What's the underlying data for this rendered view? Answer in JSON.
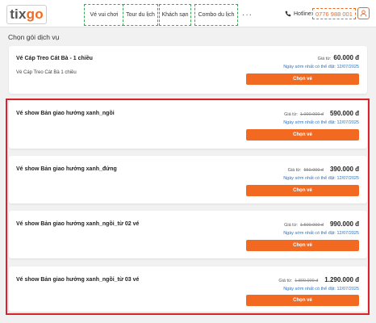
{
  "header": {
    "logo": {
      "tix": "tix",
      "go": "go"
    },
    "nav": [
      "Vé vui chơi",
      "Tour du lịch",
      "Khách sạn",
      "Combo du lịch"
    ],
    "more": "···",
    "hotline_label": "Hotline:",
    "hotline_number": "0776 988 001"
  },
  "section_title": "Chọn gói dịch vụ",
  "packages": [
    {
      "name": "Vé Cáp Treo Cát Bà - 1 chiều",
      "description": "Vé Cáp Treo Cát Bà 1 chiều",
      "price_label": "Giá từ:",
      "old_price": "",
      "price": "60.000 đ",
      "date_note": "Ngày sớm nhất có thể đặt: 12/07/2025",
      "button": "Chọn vé"
    },
    {
      "name": "Vé show Bản giao hưởng xanh_ngồi",
      "description": "",
      "price_label": "Giá từ:",
      "old_price": "1.000.000 đ",
      "price": "590.000 đ",
      "date_note": "Ngày sớm nhất có thể đặt: 12/07/2025",
      "button": "Chọn vé"
    },
    {
      "name": "Vé show Bản giao hưởng xanh_đứng",
      "description": "",
      "price_label": "Giá từ:",
      "old_price": "550.000 đ",
      "price": "390.000 đ",
      "date_note": "Ngày sớm nhất có thể đặt: 12/07/2025",
      "button": "Chọn vé"
    },
    {
      "name": "Vé show Bản giao hưởng xanh_ngồi_từ 02 vé",
      "description": "",
      "price_label": "Giá từ:",
      "old_price": "1.500.000 đ",
      "price": "990.000 đ",
      "date_note": "Ngày sớm nhất có thể đặt: 12/07/2025",
      "button": "Chọn vé"
    },
    {
      "name": "Vé show Bản giao hưởng xanh_ngồi_từ 03 vé",
      "description": "",
      "price_label": "Giá từ:",
      "old_price": "1.800.000 đ",
      "price": "1.290.000 đ",
      "date_note": "Ngày sớm nhất có thể đặt: 12/07/2025",
      "button": "Chọn vé"
    }
  ],
  "colors": {
    "accent": "#f26a21",
    "link": "#2a73c4",
    "highlight": "#d9232b",
    "nav_border": "#3aa65a"
  }
}
